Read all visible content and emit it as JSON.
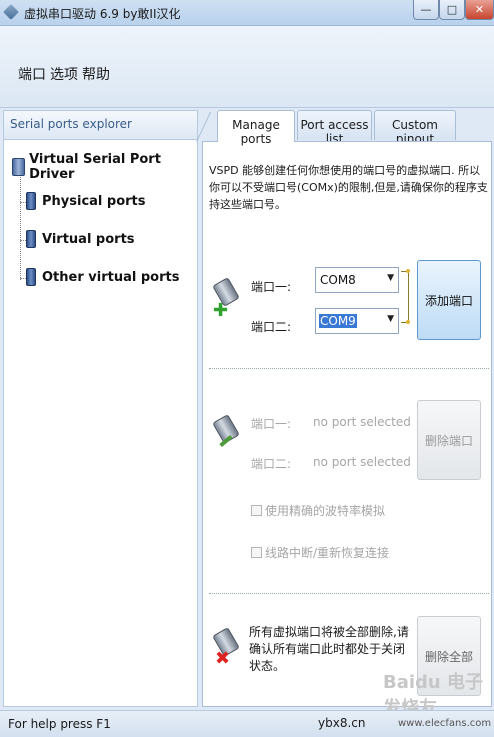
{
  "window": {
    "title": "虚拟串口驱动 6.9 by敢II汉化",
    "minimize_glyph": "—",
    "maximize_glyph": "□",
    "close_glyph": "✕"
  },
  "menu": {
    "items": [
      "端口",
      "选项",
      "帮助"
    ]
  },
  "explorer": {
    "header": "Serial ports explorer",
    "root": "Virtual Serial Port Driver",
    "children": [
      "Physical ports",
      "Virtual ports",
      "Other virtual ports"
    ]
  },
  "tabs": {
    "items": [
      "Manage ports",
      "Port access list",
      "Custom pinout"
    ],
    "active": "Manage ports"
  },
  "manage": {
    "description": "VSPD 能够创建任何你想使用的端口号的虚拟端口. 所以你可以不受端口号(COMx)的限制,但是,请确保你的程序支持这些端口号。",
    "add": {
      "port1_label": "端口一:",
      "port2_label": "端口二:",
      "port1_value": "COM8",
      "port2_value": "COM9",
      "button": "添加端口"
    },
    "remove": {
      "port1_label": "端口一:",
      "port2_label": "端口二:",
      "port1_value": "no port selected",
      "port2_value": "no port selected",
      "button": "删除端口",
      "option1": "使用精确的波特率模拟",
      "option2": "线路中断/重新恢复连接"
    },
    "delete_all": {
      "text": "所有虚拟端口将被全部删除,请确认所有端口此时都处于关闭状态。",
      "button": "删除全部"
    }
  },
  "statusbar": {
    "text": "For help press F1",
    "watermark1": "ybx8.cn",
    "watermark2": "www.elecfans.com",
    "watermark_logo": "Baidu 电子发烧友"
  },
  "colors": {
    "accent": "#3a78d6",
    "close_button": "#c7442f",
    "disabled_text": "#a6a6a6"
  }
}
